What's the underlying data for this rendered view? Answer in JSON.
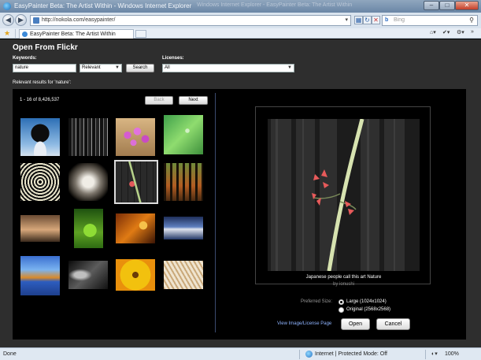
{
  "window": {
    "title": "EasyPainter Beta: The Artist Within - Windows Internet Explorer",
    "ghost_title": "Windows Internet Explorer - EasyPainter Beta: The Artist Within"
  },
  "browser": {
    "url": "http://nokola.com/easypainter/",
    "search_placeholder": "Bing",
    "tab_label": "EasyPainter Beta: The Artist Within",
    "commands": [
      "Page",
      "Safety",
      "Tools"
    ]
  },
  "dialog": {
    "title": "Open From Flickr",
    "keywords_label": "Keywords:",
    "keywords_value": "nature",
    "sort_value": "Relevant",
    "search_label": "Search",
    "licenses_label": "Licenses:",
    "license_value": "All",
    "relevant_text": "Relevant results for 'nature':",
    "count_text": "1 - 16 of 8,426,537",
    "back_label": "Back",
    "next_label": "Next",
    "thumbnails": [
      {
        "name": "tree-sky"
      },
      {
        "name": "forest-bw"
      },
      {
        "name": "pink-flowers"
      },
      {
        "name": "green-leaf"
      },
      {
        "name": "spiral-rings"
      },
      {
        "name": "cave-tunnel"
      },
      {
        "name": "red-plant-fence"
      },
      {
        "name": "autumn-forest"
      },
      {
        "name": "dock-sunset"
      },
      {
        "name": "green-frog"
      },
      {
        "name": "orange-leaves"
      },
      {
        "name": "ocean-clouds"
      },
      {
        "name": "lake-reflection"
      },
      {
        "name": "dark-leaves"
      },
      {
        "name": "gerbera-flower"
      },
      {
        "name": "dry-grass"
      }
    ],
    "selected_index": 6,
    "preview_caption": "Japanese people call this art Nature",
    "preview_byline": "by ionushi",
    "preferred_size_label": "Preferred Size:",
    "size_options": [
      "Large (1024x1024)",
      "Original (2568x2568)"
    ],
    "selected_size": 0,
    "view_link": "View Image/License Page",
    "open_label": "Open",
    "cancel_label": "Cancel"
  },
  "status": {
    "left": "Done",
    "zone": "Internet | Protected Mode: Off",
    "zoom": "100%"
  }
}
